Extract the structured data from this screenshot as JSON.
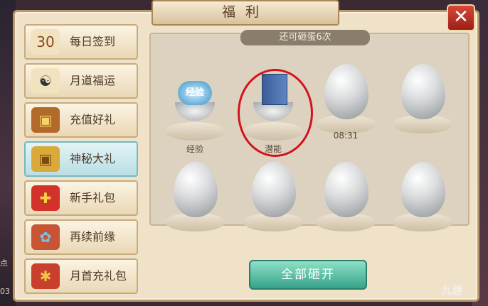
{
  "window": {
    "title": "福利",
    "close_label": "✕"
  },
  "sidebar": {
    "items": [
      {
        "label": "每日签到",
        "icon": "calendar-30-icon",
        "active": false
      },
      {
        "label": "月道福运",
        "icon": "yin-yang-scroll-icon",
        "active": false
      },
      {
        "label": "充值好礼",
        "icon": "treasure-chest-icon",
        "active": false
      },
      {
        "label": "神秘大礼",
        "icon": "golden-chest-icon",
        "active": true
      },
      {
        "label": "新手礼包",
        "icon": "red-gift-box-icon",
        "active": false
      },
      {
        "label": "再续前缘",
        "icon": "gift-bundle-icon",
        "active": false
      },
      {
        "label": "月首充礼包",
        "icon": "red-money-bag-icon",
        "active": false
      }
    ]
  },
  "eggs": {
    "counter": "还可砸蛋6次",
    "row1": [
      {
        "label": "经验",
        "prize_text": "经验",
        "state": "opened"
      },
      {
        "label": "潜能",
        "state": "opened"
      },
      {
        "label": "08:31",
        "state": "egg"
      },
      {
        "label": "",
        "state": "egg"
      }
    ],
    "row2": [
      {
        "state": "egg"
      },
      {
        "state": "egg"
      },
      {
        "state": "egg"
      },
      {
        "state": "egg"
      }
    ]
  },
  "actions": {
    "smash_all": "全部砸开"
  },
  "watermark": "九游",
  "background_edge_text": [
    "点",
    "03"
  ],
  "colors": {
    "close_button": "#c0392b",
    "smash_all_button": "#4fb79c",
    "highlight_circle": "#d4121e"
  }
}
